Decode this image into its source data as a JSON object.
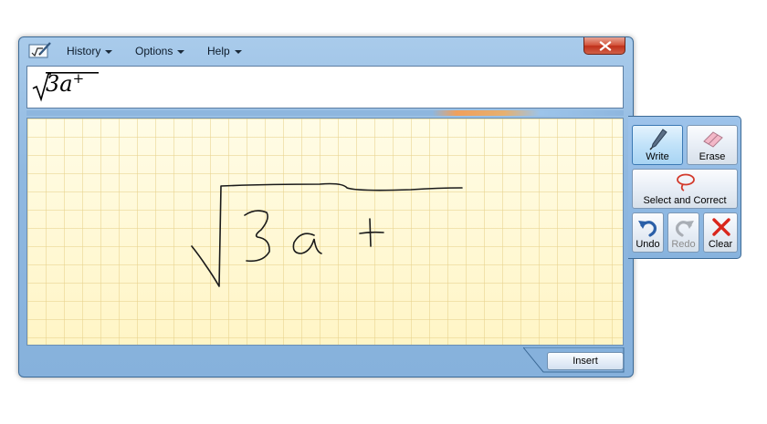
{
  "menu": {
    "history": "History",
    "options": "Options",
    "help": "Help"
  },
  "preview": {
    "expression": "3a",
    "superscript": "+"
  },
  "insert_label": "Insert",
  "tools": {
    "write": "Write",
    "erase": "Erase",
    "select_correct": "Select and Correct",
    "undo": "Undo",
    "redo": "Redo",
    "clear": "Clear"
  },
  "colors": {
    "frame": "#8fb8e0",
    "pad_background": "#fff6c8",
    "close_button": "#c0301a",
    "clear_icon": "#d9261c",
    "undo_icon": "#2a5fa8",
    "select_icon": "#d33a2c"
  },
  "icons": {
    "app": "math-input-pen-icon",
    "close": "close-icon",
    "write": "pen-icon",
    "erase": "eraser-icon",
    "select_correct": "lasso-icon",
    "undo": "undo-arrow-icon",
    "redo": "redo-arrow-icon",
    "clear": "red-x-icon"
  }
}
